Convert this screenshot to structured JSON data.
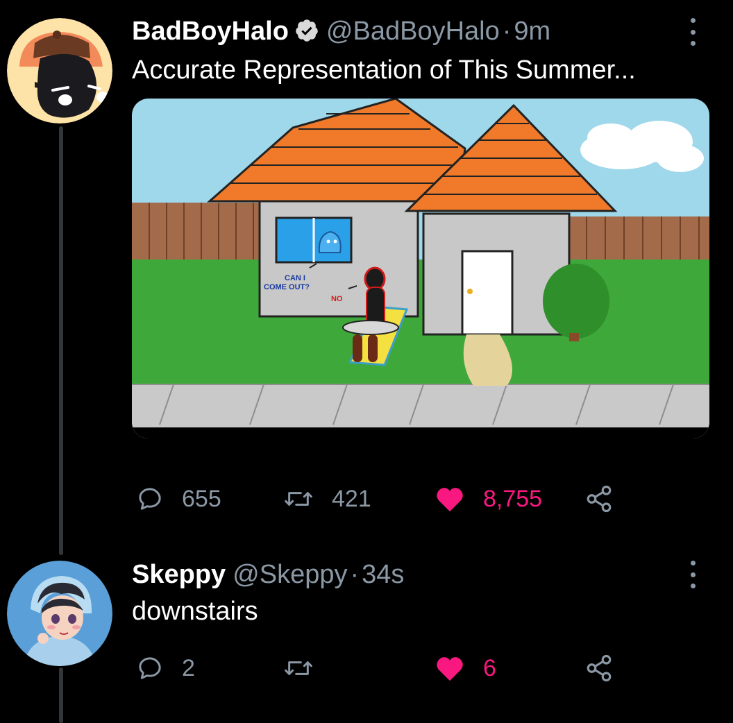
{
  "thread": [
    {
      "author": {
        "name": "BadBoyHalo",
        "handle": "@BadBoyHalo",
        "verified": true,
        "avatar": "dark-blob-avatar"
      },
      "time": "9m",
      "text": "Accurate Representation of This Summer...",
      "image": {
        "captions": {
          "can_i": "CAN I",
          "come_out": "COME OUT?",
          "no": "NO"
        }
      },
      "stats": {
        "replies": "655",
        "retweets": "421",
        "likes": "8,755"
      },
      "liked": true
    },
    {
      "author": {
        "name": "Skeppy",
        "handle": "@Skeppy",
        "verified": false,
        "avatar": "blue-hoodie-avatar"
      },
      "time": "34s",
      "text": "downstairs",
      "stats": {
        "replies": "2",
        "retweets": "",
        "likes": "6"
      },
      "liked": true
    }
  ],
  "colors": {
    "background": "#000000",
    "muted": "#8b98a5",
    "like": "#f91880",
    "thread_line": "#333639"
  },
  "icons": [
    "reply-icon",
    "retweet-icon",
    "like-icon",
    "share-icon",
    "more-icon",
    "verified-badge-icon"
  ]
}
